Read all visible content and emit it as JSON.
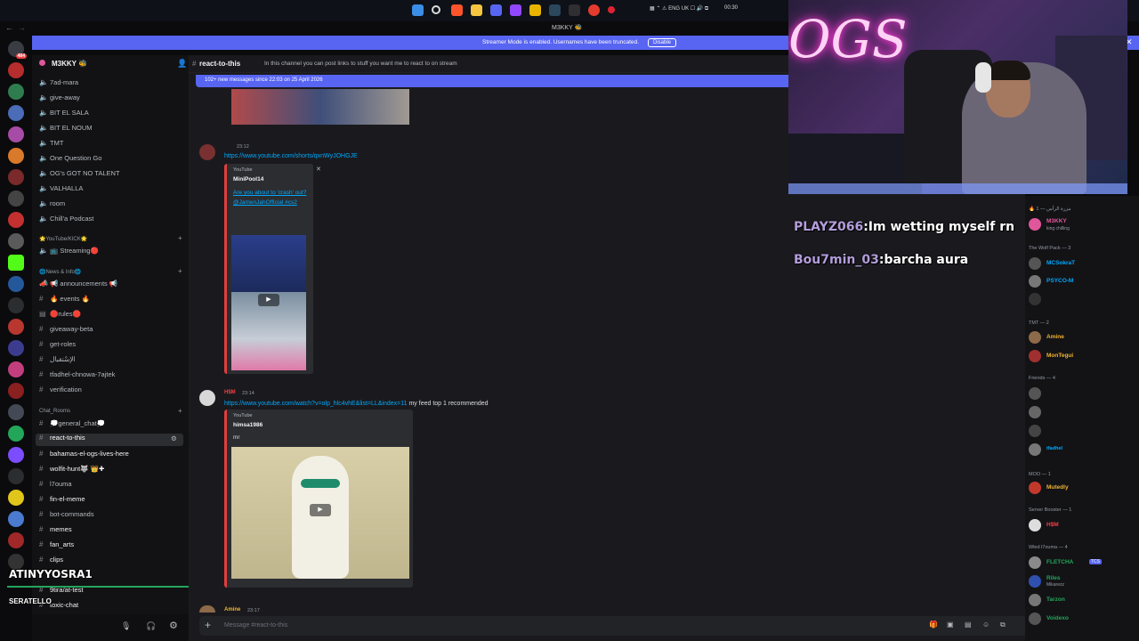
{
  "window": {
    "title": "M3KKY 🐝",
    "time": "00:30"
  },
  "banner": {
    "text": "Streamer Mode is enabled. Usernames have been truncated.",
    "button": "Disable"
  },
  "server": {
    "name": "M3KKY 🐝"
  },
  "channels": {
    "top": [
      "7ad-mara",
      "give-away",
      "BIT EL SALA",
      "BIT EL NOUM",
      "TMT",
      "One Question Go",
      "OG's GOT NO TALENT",
      "VALHALLA",
      "room",
      "Chill'a Podcast"
    ],
    "cat_youtube": "🌟YouTube/KICK🌟",
    "youtube": [
      "📺 Streaming🔴"
    ],
    "cat_news": "🌐News & Info🌐",
    "news": [
      "📢 announcements 📢",
      "🔥 events 🔥",
      "🛑rules🛑",
      "giveaway-beta",
      "get-roles",
      "الإسْتقبال",
      "tfadhel-chnowa-7ajtek",
      "verification"
    ],
    "cat_chat": "Chat_Rooms",
    "chat": [
      "💭general_chat💭",
      "react-to-this",
      "bahamas-el-ogs-lives-here",
      "wolfit-hunt🐺 👑✚",
      "l7ouma",
      "fin-el-meme",
      "bot-commands",
      "memes",
      "fan_arts",
      "clips",
      "9tira/at-test",
      "toxic-chat"
    ]
  },
  "header": {
    "channel": "react-to-this",
    "topic": "In this channel you can post links to stuff you want me to react to on stream"
  },
  "new_messages": "102+ new messages since 22:03 on 25 April 2026",
  "messages": [
    {
      "time": "23:12",
      "link": "https://www.youtube.com/shorts/qxnWyJOHGJE",
      "provider": "YouTube",
      "author": "MiniPool14",
      "title": "Are you about to 'crash' out?\n@JamenJahOfficial #cs2"
    },
    {
      "user": "H$M",
      "time": "23:14",
      "link": "https://www.youtube.com/watch?v=olp_hlc4vhE&list=LL&index=11",
      "suffix": " my feed top 1 recommended",
      "provider": "YouTube",
      "author": "himsa1986",
      "title": "mr"
    },
    {
      "user": "Amine",
      "time": "23:17"
    }
  ],
  "input": {
    "placeholder": "Message #react-to-this"
  },
  "members": {
    "cat0": "🔥 مزرة الرأس — 1",
    "m0": "M3KKY",
    "m0_status": "king chilling",
    "cat1": "The Wolf Pack — 3",
    "cat1_members": [
      "MCSokraT",
      "PSYCO-M"
    ],
    "cat2": "TMT — 2",
    "cat2_members": [
      "Amine",
      "MonTegui"
    ],
    "cat3": "Friends — 4",
    "cat3_members": [
      "tfadhel"
    ],
    "cat4": "MOO — 1",
    "cat4_members": [
      "Mutedly"
    ],
    "cat5": "Server Booster — 1",
    "cat5_members": [
      "H$M"
    ],
    "cat6": "Wled l7ouma — 4",
    "cat6_members": [
      "FLETCHA",
      "Riles",
      "Tarzon",
      "Voidexo"
    ],
    "riles_status": "Mikarezz",
    "fletcha_tag": "TCS"
  },
  "stream_chat": [
    {
      "user": "PLAYZ066",
      "text": ":Im wetting myself rn"
    },
    {
      "user": "Bou7min_03",
      "text": ":barcha aura"
    }
  ],
  "voice_overlay": {
    "user": "ATINYYOSRA1",
    "user2": "SERATELLO"
  },
  "colors": {
    "accent": "#5865f2",
    "link": "#00a8fc",
    "embed_border": "#e03e3e",
    "green": "#23a55a"
  }
}
